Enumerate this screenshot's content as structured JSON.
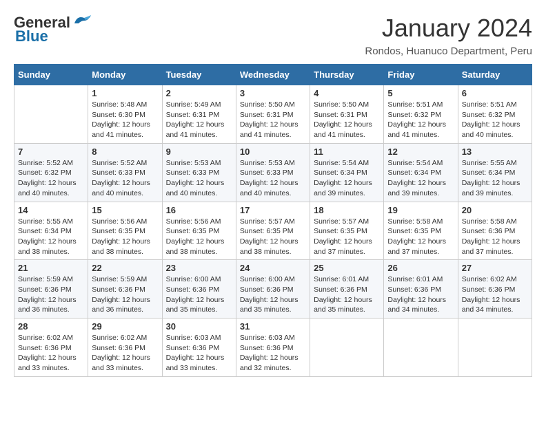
{
  "header": {
    "logo_general": "General",
    "logo_blue": "Blue",
    "month_title": "January 2024",
    "location": "Rondos, Huanuco Department, Peru"
  },
  "days_of_week": [
    "Sunday",
    "Monday",
    "Tuesday",
    "Wednesday",
    "Thursday",
    "Friday",
    "Saturday"
  ],
  "weeks": [
    [
      {
        "day": "",
        "sunrise": "",
        "sunset": "",
        "daylight": ""
      },
      {
        "day": "1",
        "sunrise": "Sunrise: 5:48 AM",
        "sunset": "Sunset: 6:30 PM",
        "daylight": "Daylight: 12 hours and 41 minutes."
      },
      {
        "day": "2",
        "sunrise": "Sunrise: 5:49 AM",
        "sunset": "Sunset: 6:31 PM",
        "daylight": "Daylight: 12 hours and 41 minutes."
      },
      {
        "day": "3",
        "sunrise": "Sunrise: 5:50 AM",
        "sunset": "Sunset: 6:31 PM",
        "daylight": "Daylight: 12 hours and 41 minutes."
      },
      {
        "day": "4",
        "sunrise": "Sunrise: 5:50 AM",
        "sunset": "Sunset: 6:31 PM",
        "daylight": "Daylight: 12 hours and 41 minutes."
      },
      {
        "day": "5",
        "sunrise": "Sunrise: 5:51 AM",
        "sunset": "Sunset: 6:32 PM",
        "daylight": "Daylight: 12 hours and 41 minutes."
      },
      {
        "day": "6",
        "sunrise": "Sunrise: 5:51 AM",
        "sunset": "Sunset: 6:32 PM",
        "daylight": "Daylight: 12 hours and 40 minutes."
      }
    ],
    [
      {
        "day": "7",
        "sunrise": "Sunrise: 5:52 AM",
        "sunset": "Sunset: 6:32 PM",
        "daylight": "Daylight: 12 hours and 40 minutes."
      },
      {
        "day": "8",
        "sunrise": "Sunrise: 5:52 AM",
        "sunset": "Sunset: 6:33 PM",
        "daylight": "Daylight: 12 hours and 40 minutes."
      },
      {
        "day": "9",
        "sunrise": "Sunrise: 5:53 AM",
        "sunset": "Sunset: 6:33 PM",
        "daylight": "Daylight: 12 hours and 40 minutes."
      },
      {
        "day": "10",
        "sunrise": "Sunrise: 5:53 AM",
        "sunset": "Sunset: 6:33 PM",
        "daylight": "Daylight: 12 hours and 40 minutes."
      },
      {
        "day": "11",
        "sunrise": "Sunrise: 5:54 AM",
        "sunset": "Sunset: 6:34 PM",
        "daylight": "Daylight: 12 hours and 39 minutes."
      },
      {
        "day": "12",
        "sunrise": "Sunrise: 5:54 AM",
        "sunset": "Sunset: 6:34 PM",
        "daylight": "Daylight: 12 hours and 39 minutes."
      },
      {
        "day": "13",
        "sunrise": "Sunrise: 5:55 AM",
        "sunset": "Sunset: 6:34 PM",
        "daylight": "Daylight: 12 hours and 39 minutes."
      }
    ],
    [
      {
        "day": "14",
        "sunrise": "Sunrise: 5:55 AM",
        "sunset": "Sunset: 6:34 PM",
        "daylight": "Daylight: 12 hours and 38 minutes."
      },
      {
        "day": "15",
        "sunrise": "Sunrise: 5:56 AM",
        "sunset": "Sunset: 6:35 PM",
        "daylight": "Daylight: 12 hours and 38 minutes."
      },
      {
        "day": "16",
        "sunrise": "Sunrise: 5:56 AM",
        "sunset": "Sunset: 6:35 PM",
        "daylight": "Daylight: 12 hours and 38 minutes."
      },
      {
        "day": "17",
        "sunrise": "Sunrise: 5:57 AM",
        "sunset": "Sunset: 6:35 PM",
        "daylight": "Daylight: 12 hours and 38 minutes."
      },
      {
        "day": "18",
        "sunrise": "Sunrise: 5:57 AM",
        "sunset": "Sunset: 6:35 PM",
        "daylight": "Daylight: 12 hours and 37 minutes."
      },
      {
        "day": "19",
        "sunrise": "Sunrise: 5:58 AM",
        "sunset": "Sunset: 6:35 PM",
        "daylight": "Daylight: 12 hours and 37 minutes."
      },
      {
        "day": "20",
        "sunrise": "Sunrise: 5:58 AM",
        "sunset": "Sunset: 6:36 PM",
        "daylight": "Daylight: 12 hours and 37 minutes."
      }
    ],
    [
      {
        "day": "21",
        "sunrise": "Sunrise: 5:59 AM",
        "sunset": "Sunset: 6:36 PM",
        "daylight": "Daylight: 12 hours and 36 minutes."
      },
      {
        "day": "22",
        "sunrise": "Sunrise: 5:59 AM",
        "sunset": "Sunset: 6:36 PM",
        "daylight": "Daylight: 12 hours and 36 minutes."
      },
      {
        "day": "23",
        "sunrise": "Sunrise: 6:00 AM",
        "sunset": "Sunset: 6:36 PM",
        "daylight": "Daylight: 12 hours and 35 minutes."
      },
      {
        "day": "24",
        "sunrise": "Sunrise: 6:00 AM",
        "sunset": "Sunset: 6:36 PM",
        "daylight": "Daylight: 12 hours and 35 minutes."
      },
      {
        "day": "25",
        "sunrise": "Sunrise: 6:01 AM",
        "sunset": "Sunset: 6:36 PM",
        "daylight": "Daylight: 12 hours and 35 minutes."
      },
      {
        "day": "26",
        "sunrise": "Sunrise: 6:01 AM",
        "sunset": "Sunset: 6:36 PM",
        "daylight": "Daylight: 12 hours and 34 minutes."
      },
      {
        "day": "27",
        "sunrise": "Sunrise: 6:02 AM",
        "sunset": "Sunset: 6:36 PM",
        "daylight": "Daylight: 12 hours and 34 minutes."
      }
    ],
    [
      {
        "day": "28",
        "sunrise": "Sunrise: 6:02 AM",
        "sunset": "Sunset: 6:36 PM",
        "daylight": "Daylight: 12 hours and 33 minutes."
      },
      {
        "day": "29",
        "sunrise": "Sunrise: 6:02 AM",
        "sunset": "Sunset: 6:36 PM",
        "daylight": "Daylight: 12 hours and 33 minutes."
      },
      {
        "day": "30",
        "sunrise": "Sunrise: 6:03 AM",
        "sunset": "Sunset: 6:36 PM",
        "daylight": "Daylight: 12 hours and 33 minutes."
      },
      {
        "day": "31",
        "sunrise": "Sunrise: 6:03 AM",
        "sunset": "Sunset: 6:36 PM",
        "daylight": "Daylight: 12 hours and 32 minutes."
      },
      {
        "day": "",
        "sunrise": "",
        "sunset": "",
        "daylight": ""
      },
      {
        "day": "",
        "sunrise": "",
        "sunset": "",
        "daylight": ""
      },
      {
        "day": "",
        "sunrise": "",
        "sunset": "",
        "daylight": ""
      }
    ]
  ]
}
